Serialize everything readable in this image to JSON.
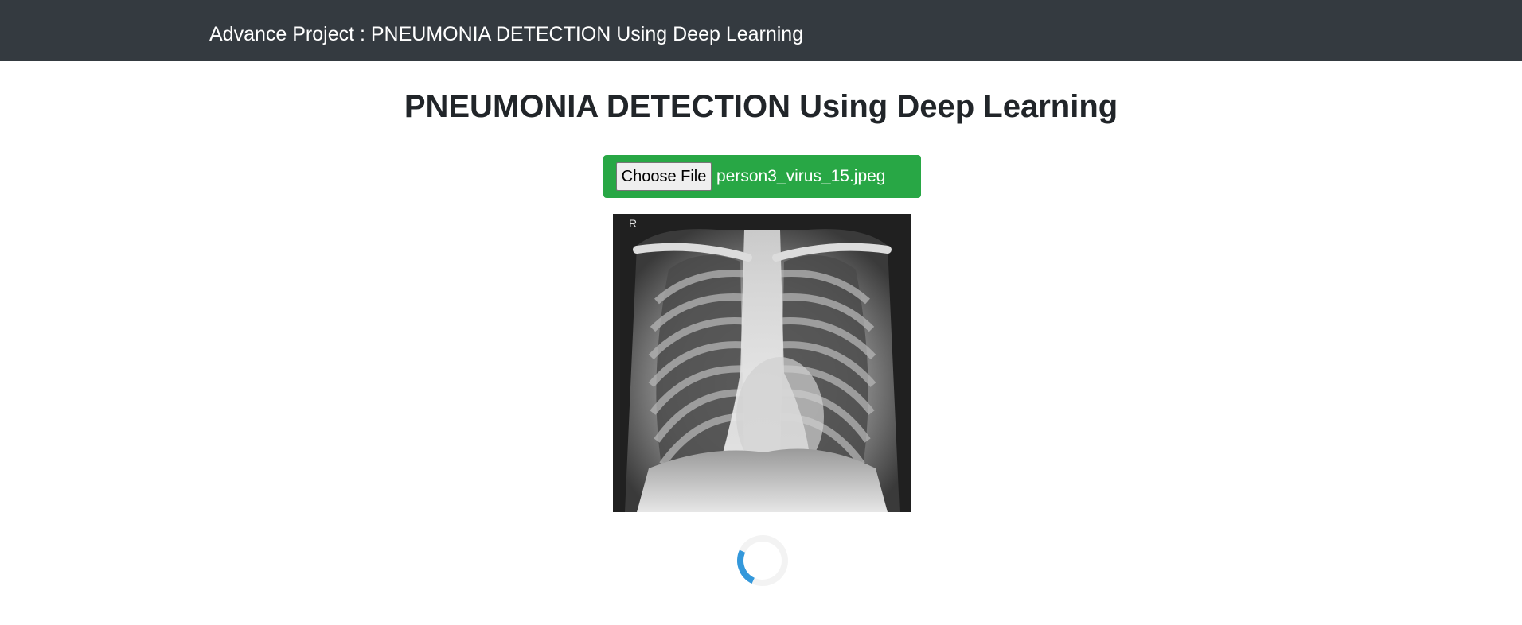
{
  "navbar": {
    "brand": "Advance Project : PNEUMONIA DETECTION Using Deep Learning"
  },
  "main": {
    "title": "PNEUMONIA DETECTION Using Deep Learning",
    "upload": {
      "button_label": "Choose File",
      "file_name": "person3_virus_15.jpeg"
    },
    "preview": {
      "marker": "R"
    },
    "loader": {
      "icon": "spinner-icon"
    }
  },
  "colors": {
    "navbar_bg": "#343a40",
    "upload_bg": "#28a745",
    "spinner_accent": "#3498db",
    "spinner_track": "#f3f3f3"
  }
}
